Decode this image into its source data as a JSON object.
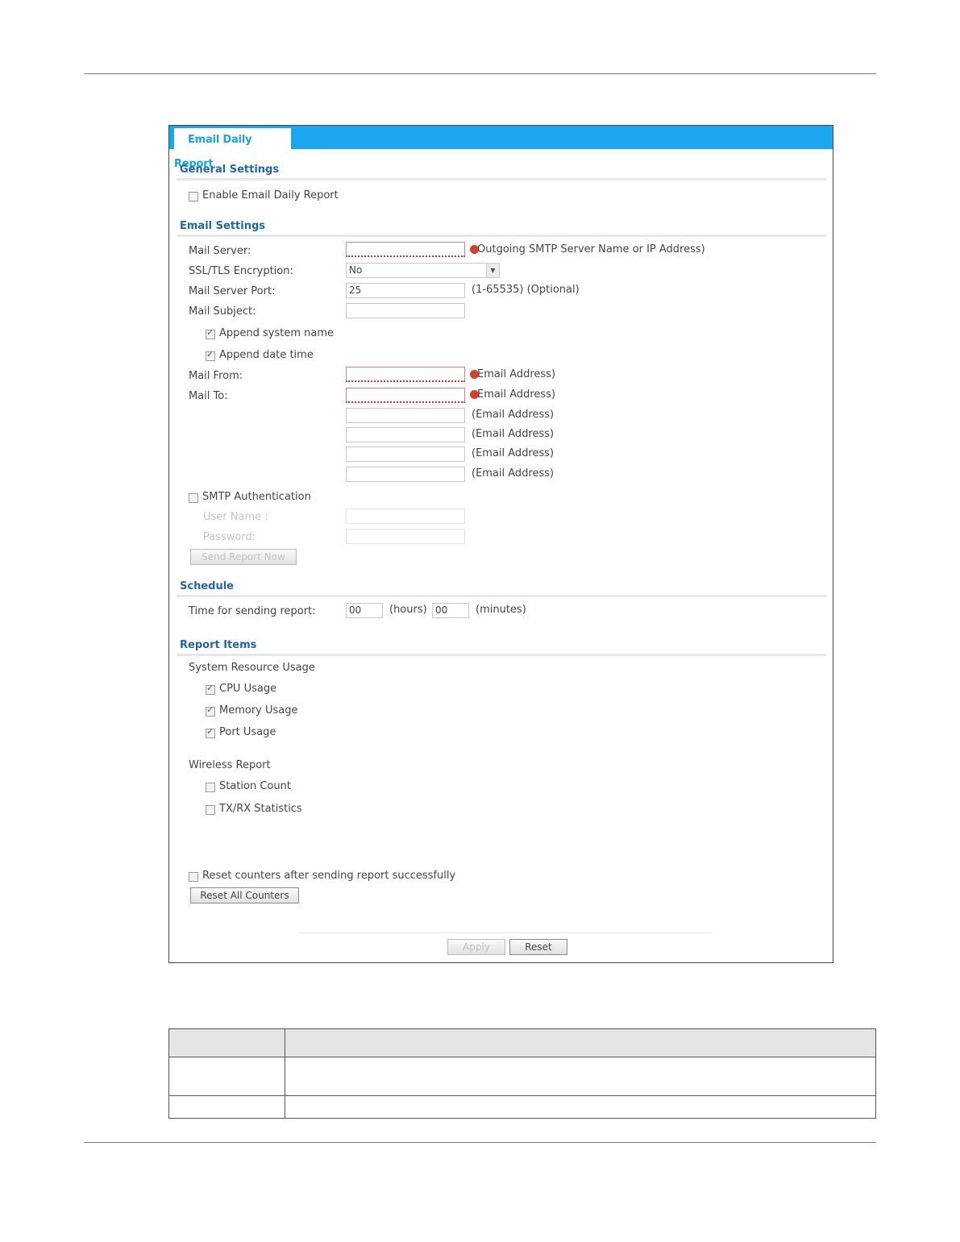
{
  "tab": {
    "label": "Email Daily Report"
  },
  "general": {
    "heading": "General Settings",
    "enable_label": "Enable Email Daily Report",
    "enable_checked": false
  },
  "email": {
    "heading": "Email Settings",
    "mail_server_label": "Mail Server:",
    "mail_server_value": "",
    "mail_server_hint": "Outgoing SMTP Server Name or IP Address)",
    "ssl_label": "SSL/TLS Encryption:",
    "ssl_value": "No",
    "port_label": "Mail Server Port:",
    "port_value": "25",
    "port_hint": "(1-65535) (Optional)",
    "subject_label": "Mail Subject:",
    "subject_value": "",
    "append_system_name_label": "Append system name",
    "append_system_name_checked": true,
    "append_date_time_label": "Append date time",
    "append_date_time_checked": true,
    "mail_from_label": "Mail From:",
    "mail_from_hint": "Email Address)",
    "mail_to_label": "Mail To:",
    "mail_to_hint": "Email Address)",
    "email_hint": "(Email Address)",
    "smtp_auth_label": "SMTP Authentication",
    "smtp_auth_checked": false,
    "user_name_label": "User Name :",
    "password_label": "Password:",
    "send_now_label": "Send Report Now"
  },
  "schedule": {
    "heading": "Schedule",
    "time_label": "Time for sending report:",
    "hours_value": "00",
    "hours_unit": "(hours)",
    "minutes_value": "00",
    "minutes_unit": "(minutes)"
  },
  "report_items": {
    "heading": "Report Items",
    "system_resource_label": "System Resource Usage",
    "cpu_label": "CPU Usage",
    "cpu_checked": true,
    "memory_label": "Memory Usage",
    "memory_checked": true,
    "port_label": "Port Usage",
    "port_checked": true,
    "wireless_label": "Wireless Report",
    "station_label": "Station Count",
    "station_checked": false,
    "txrx_label": "TX/RX Statistics",
    "txrx_checked": false
  },
  "footer": {
    "reset_counters_label": "Reset counters after sending report successfully",
    "reset_counters_checked": false,
    "reset_all_label": "Reset All Counters",
    "apply_label": "Apply",
    "reset_label": "Reset"
  },
  "colors": {
    "tab_bar": "#1ba6ef",
    "section_heading": "#2266a6",
    "required_warning": "#d8402a"
  }
}
